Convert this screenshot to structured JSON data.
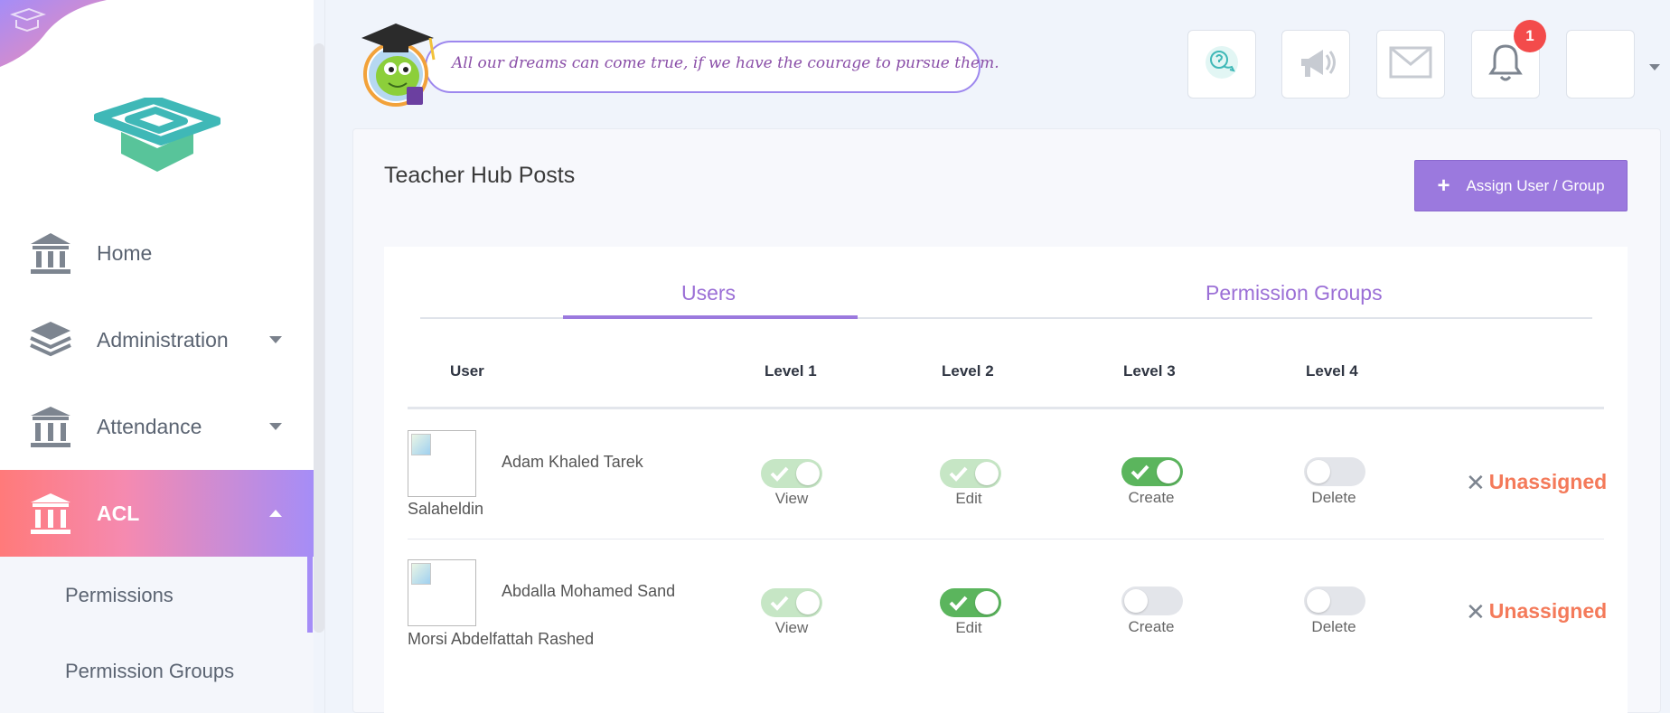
{
  "sidebar": {
    "items": [
      {
        "label": "Home",
        "icon": "building-icon"
      },
      {
        "label": "Administration",
        "icon": "layers-icon"
      },
      {
        "label": "Attendance",
        "icon": "columns-icon"
      },
      {
        "label": "ACL",
        "icon": "columns-icon"
      }
    ],
    "submenu": [
      {
        "label": "Permissions"
      },
      {
        "label": "Permission Groups"
      }
    ]
  },
  "header": {
    "motto": "All our dreams can come true, if we have the courage to pursue them.",
    "notification_count": "1"
  },
  "page": {
    "title": "Teacher Hub Posts",
    "assign_button": "Assign User / Group",
    "tabs": [
      {
        "label": "Users",
        "active": true
      },
      {
        "label": "Permission Groups",
        "active": false
      }
    ],
    "columns": [
      "User",
      "Level 1",
      "Level 2",
      "Level 3",
      "Level 4"
    ],
    "rows": [
      {
        "name_line1": "Adam Khaled Tarek",
        "name_line2": "Salaheldin",
        "toggles": [
          {
            "label": "View",
            "state": "on-disabled"
          },
          {
            "label": "Edit",
            "state": "on-disabled"
          },
          {
            "label": "Create",
            "state": "on"
          },
          {
            "label": "Delete",
            "state": "off"
          }
        ],
        "action": "Unassigned"
      },
      {
        "name_line1": "Abdalla Mohamed Sand",
        "name_line2": "Morsi Abdelfattah  Rashed",
        "toggles": [
          {
            "label": "View",
            "state": "on-disabled"
          },
          {
            "label": "Edit",
            "state": "on"
          },
          {
            "label": "Create",
            "state": "off"
          },
          {
            "label": "Delete",
            "state": "off"
          }
        ],
        "action": "Unassigned"
      }
    ]
  },
  "colors": {
    "accent": "#9b79de",
    "toggle_on": "#5bb55d",
    "unassigned": "#f47a5a",
    "badge": "#f34b4b"
  }
}
